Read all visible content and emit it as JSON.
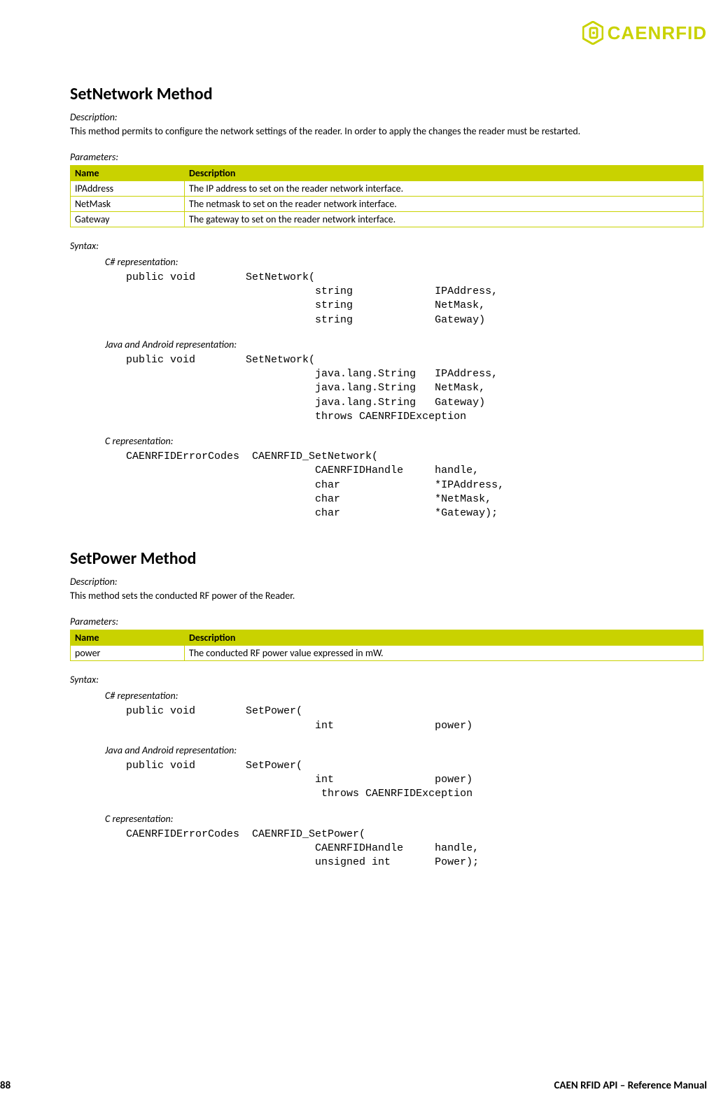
{
  "logo_text": "CAENRFID",
  "method1": {
    "title": "SetNetwork Method",
    "desc_label": "Description:",
    "desc_text": "This method permits to configure the network settings of the reader. In order to apply the changes the reader must be restarted.",
    "params_label": "Parameters:",
    "table_headers": [
      "Name",
      "Description"
    ],
    "table_rows": [
      [
        "IPAddress",
        "The IP address to set on the reader network interface."
      ],
      [
        "NetMask",
        "The netmask to set on the reader network interface."
      ],
      [
        "Gateway",
        "The gateway to set on the reader network interface."
      ]
    ],
    "syntax_label": "Syntax:",
    "csharp_label": "C# representation:",
    "csharp_code": "public void        SetNetwork(\n                              string             IPAddress,\n                              string             NetMask,\n                              string             Gateway)",
    "java_label": "Java and Android representation:",
    "java_code": "public void        SetNetwork(\n                              java.lang.String   IPAddress,\n                              java.lang.String   NetMask,\n                              java.lang.String   Gateway)\n                              throws CAENRFIDException",
    "c_label": "C representation:",
    "c_code": "CAENRFIDErrorCodes  CAENRFID_SetNetwork(\n                              CAENRFIDHandle     handle,\n                              char               *IPAddress,\n                              char               *NetMask,\n                              char               *Gateway);"
  },
  "method2": {
    "title": "SetPower Method",
    "desc_label": "Description:",
    "desc_text": "This method sets the conducted RF power of the Reader.",
    "params_label": "Parameters:",
    "table_headers": [
      "Name",
      "Description"
    ],
    "table_rows": [
      [
        "power",
        "The conducted RF power value expressed in mW."
      ]
    ],
    "syntax_label": "Syntax:",
    "csharp_label": "C# representation:",
    "csharp_code": "public void        SetPower(\n                              int                power)",
    "java_label": "Java and Android representation:",
    "java_code": "public void        SetPower(\n                              int                power)\n                               throws CAENRFIDException",
    "c_label": "C representation:",
    "c_code": "CAENRFIDErrorCodes  CAENRFID_SetPower(\n                              CAENRFIDHandle     handle,\n                              unsigned int       Power);"
  },
  "footer": {
    "page_number": "88",
    "doc_title": "CAEN RFID API – Reference Manual"
  }
}
